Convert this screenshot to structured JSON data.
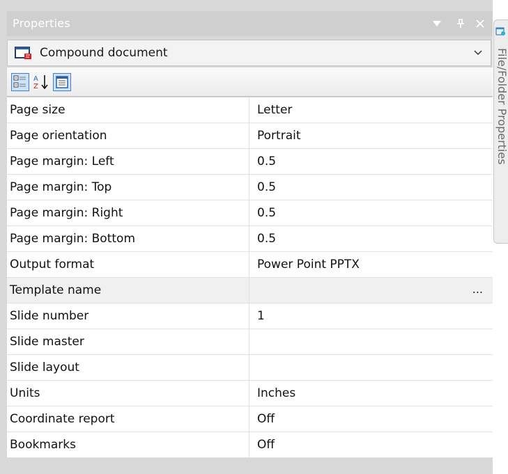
{
  "window": {
    "title": "Properties",
    "buttons": {
      "dropdown_icon": "triangle-down-icon",
      "pin_icon": "pin-icon",
      "close_icon": "close-icon"
    }
  },
  "object_selector": {
    "value": "Compound document",
    "icon": "compound-document-icon",
    "arrow_icon": "chevron-down-icon"
  },
  "toolbar": {
    "tools": [
      {
        "name": "categorized-icon"
      },
      {
        "name": "sort-alphabetical-icon"
      },
      {
        "name": "property-pages-icon"
      }
    ]
  },
  "properties": [
    {
      "name": "Page size",
      "value": "Letter"
    },
    {
      "name": "Page orientation",
      "value": "Portrait"
    },
    {
      "name": "Page margin: Left",
      "value": "0.5"
    },
    {
      "name": "Page margin: Top",
      "value": "0.5"
    },
    {
      "name": "Page margin: Right",
      "value": "0.5"
    },
    {
      "name": "Page margin: Bottom",
      "value": "0.5"
    },
    {
      "name": "Output format",
      "value": "Power Point PPTX"
    },
    {
      "name": "Template name",
      "value": "",
      "button": "...",
      "selected": true
    },
    {
      "name": "Slide number",
      "value": "1"
    },
    {
      "name": "Slide master",
      "value": ""
    },
    {
      "name": "Slide layout",
      "value": ""
    },
    {
      "name": "Units",
      "value": "Inches"
    },
    {
      "name": "Coordinate report",
      "value": "Off"
    },
    {
      "name": "Bookmarks",
      "value": "Off"
    }
  ],
  "side_tab": {
    "label": "File/Folder Properties",
    "icon": "folder-properties-icon"
  },
  "colors": {
    "title_bar": "#cfcfcf",
    "panel_bg": "#d8d8d8",
    "grid_line": "#e2e2e2",
    "selected_row": "#f0f0f0"
  }
}
